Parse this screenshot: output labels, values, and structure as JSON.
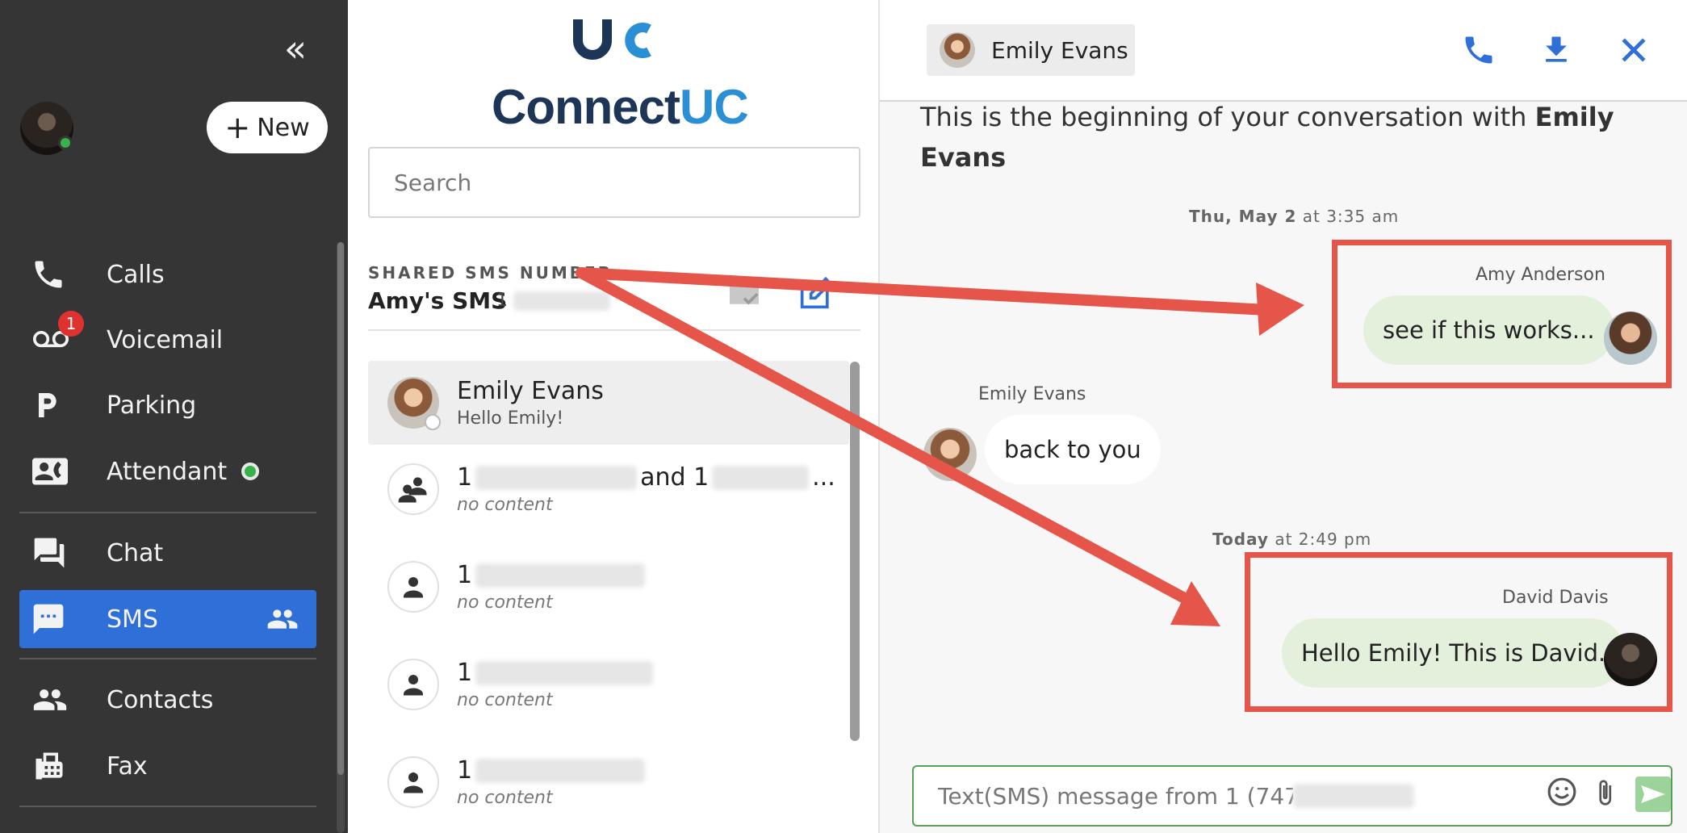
{
  "sidebar": {
    "collapse_glyph": "«",
    "new_button": {
      "plus": "+",
      "label": "New"
    },
    "nav": [
      {
        "label": "Calls",
        "icon": "phone-icon"
      },
      {
        "label": "Voicemail",
        "icon": "voicemail-icon",
        "badge": "1"
      },
      {
        "label": "Parking",
        "icon": "parking-icon"
      },
      {
        "label": "Attendant",
        "icon": "attendant-icon"
      },
      {
        "label": "Chat",
        "icon": "chat-icon"
      },
      {
        "label": "SMS",
        "icon": "sms-icon",
        "active": true
      },
      {
        "label": "Contacts",
        "icon": "contacts-icon"
      },
      {
        "label": "Fax",
        "icon": "fax-icon"
      }
    ],
    "colors": {
      "background": "#353535",
      "active": "#2f6fd8",
      "online": "#37b24d",
      "badge": "#e03131"
    }
  },
  "middle": {
    "logo": {
      "word_dark": "Connect",
      "word_accent": "UC",
      "mark": "UC"
    },
    "search_placeholder": "Search",
    "shared_label": "SHARED SMS NUMBER",
    "shared_name": "Amy's SMS",
    "shared_number_prefix": "1",
    "conversations": [
      {
        "title": "Emily Evans",
        "subtitle": "Hello Emily!",
        "selected": true
      },
      {
        "title_prefix": "1",
        "title_mid": "and 1",
        "title_suffix": "...",
        "subtitle": "no content"
      },
      {
        "title_prefix": "1",
        "subtitle": "no content"
      },
      {
        "title_prefix": "1",
        "subtitle": "no content"
      },
      {
        "title_prefix": "1",
        "subtitle": "no content"
      }
    ]
  },
  "right": {
    "contact_chip": "Emily Evans",
    "begin_text": "This is the beginning of your conversation with ",
    "begin_name": "Emily Evans",
    "messages_block": {
      "ts1_day": "Thu, May 2",
      "ts1_rest": " at 3:35 am",
      "msg1_sender": "Amy Anderson",
      "msg1_text": "see if this works...",
      "msg2_sender": "Emily Evans",
      "msg2_text": "back to you",
      "ts2_day": "Today",
      "ts2_rest": " at 2:49 pm",
      "msg3_sender": "David Davis",
      "msg3_text": "Hello Emily! This is David."
    },
    "composer_placeholder": "Text(SMS) message from 1 (747)",
    "colors": {
      "outgoing_bubble": "#e3f0dc",
      "accent": "#2f6fd8",
      "annotation": "#e5554a"
    }
  }
}
